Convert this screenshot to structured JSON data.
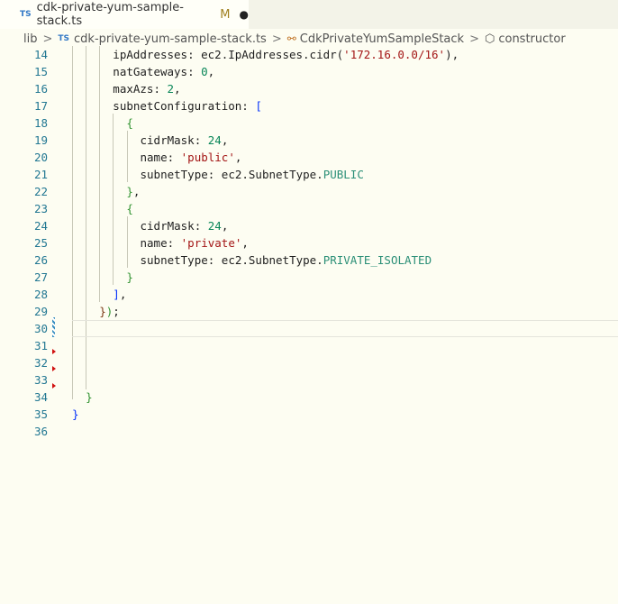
{
  "tab": {
    "icon": "TS",
    "filename": "cdk-private-yum-sample-stack.ts",
    "status": "M",
    "dirty": "●"
  },
  "breadcrumb": [
    "lib",
    "cdk-private-yum-sample-stack.ts",
    "CdkPrivateYumSampleStack",
    "constructor"
  ],
  "breadcrumb_sep": ">",
  "lines": [
    {
      "n": "14",
      "t": [
        [
          "ipAddresses: ec2.IpAddresses.cidr(",
          ""
        ],
        [
          "'172.16.0.0/16'",
          "s"
        ],
        [
          "),",
          ""
        ]
      ],
      "ind": 6
    },
    {
      "n": "15",
      "t": [
        [
          "natGateways: ",
          ""
        ],
        [
          "0",
          "n"
        ],
        [
          ",",
          ""
        ]
      ],
      "ind": 6
    },
    {
      "n": "16",
      "t": [
        [
          "maxAzs: ",
          ""
        ],
        [
          "2",
          "n"
        ],
        [
          ",",
          ""
        ]
      ],
      "ind": 6
    },
    {
      "n": "17",
      "t": [
        [
          "subnetConfiguration: ",
          ""
        ],
        [
          "[",
          "b1"
        ]
      ],
      "ind": 6
    },
    {
      "n": "18",
      "t": [
        [
          "{",
          "b2"
        ]
      ],
      "ind": 8
    },
    {
      "n": "19",
      "t": [
        [
          "cidrMask: ",
          ""
        ],
        [
          "24",
          "n"
        ],
        [
          ",",
          ""
        ]
      ],
      "ind": 10
    },
    {
      "n": "20",
      "t": [
        [
          "name: ",
          ""
        ],
        [
          "'public'",
          "s"
        ],
        [
          ",",
          ""
        ]
      ],
      "ind": 10
    },
    {
      "n": "21",
      "t": [
        [
          "subnetType: ec2.SubnetType.",
          ""
        ],
        [
          "PUBLIC",
          "e"
        ]
      ],
      "ind": 10
    },
    {
      "n": "22",
      "t": [
        [
          "}",
          "b2"
        ],
        [
          ",",
          ""
        ]
      ],
      "ind": 8
    },
    {
      "n": "23",
      "t": [
        [
          "{",
          "b2"
        ]
      ],
      "ind": 8
    },
    {
      "n": "24",
      "t": [
        [
          "cidrMask: ",
          ""
        ],
        [
          "24",
          "n"
        ],
        [
          ",",
          ""
        ]
      ],
      "ind": 10
    },
    {
      "n": "25",
      "t": [
        [
          "name: ",
          ""
        ],
        [
          "'private'",
          "s"
        ],
        [
          ",",
          ""
        ]
      ],
      "ind": 10
    },
    {
      "n": "26",
      "t": [
        [
          "subnetType: ec2.SubnetType.",
          ""
        ],
        [
          "PRIVATE_ISOLATED",
          "e"
        ]
      ],
      "ind": 10
    },
    {
      "n": "27",
      "t": [
        [
          "}",
          "b2"
        ]
      ],
      "ind": 8
    },
    {
      "n": "28",
      "t": [
        [
          "]",
          "b1"
        ],
        [
          ",",
          ""
        ]
      ],
      "ind": 6
    },
    {
      "n": "29",
      "t": [
        [
          "}",
          "b3"
        ],
        [
          ")",
          "b2"
        ],
        [
          ";",
          ""
        ]
      ],
      "ind": 4
    },
    {
      "n": "30",
      "t": [],
      "ind": 0
    },
    {
      "n": "31",
      "t": [],
      "ind": 0
    },
    {
      "n": "32",
      "t": [],
      "ind": 0
    },
    {
      "n": "33",
      "t": [],
      "ind": 0
    },
    {
      "n": "34",
      "t": [
        [
          "}",
          "b2"
        ]
      ],
      "ind": 2
    },
    {
      "n": "35",
      "t": [
        [
          "}",
          "b1"
        ]
      ],
      "ind": 0
    },
    {
      "n": "36",
      "t": [],
      "ind": 0
    }
  ]
}
